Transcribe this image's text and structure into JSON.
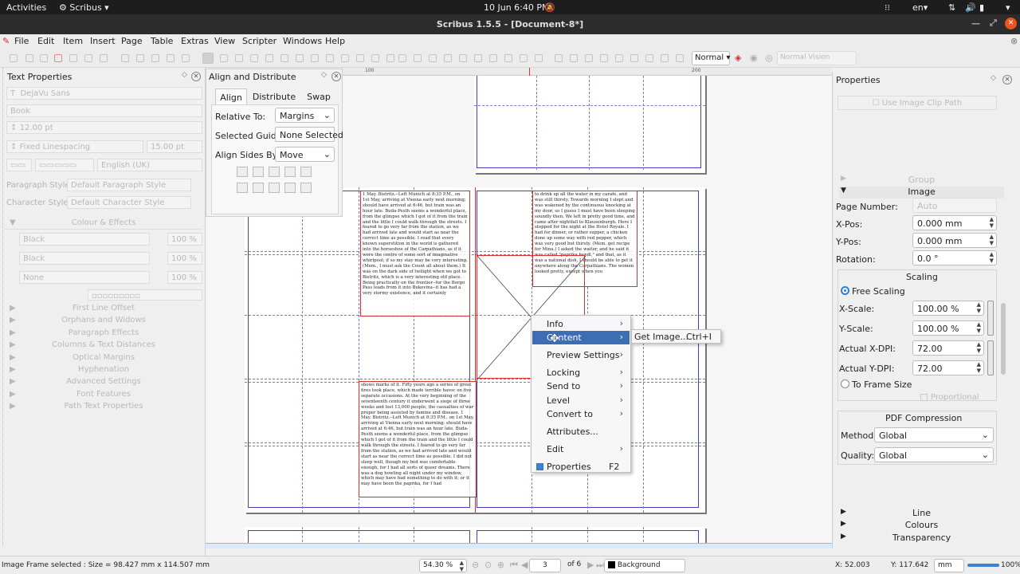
{
  "system": {
    "activities": "Activities",
    "app_menu": "Scribus ▾",
    "clock": "10 Jun  6:40 PM",
    "language": "en▾",
    "battery": "100%"
  },
  "window": {
    "title": "Scribus 1.5.5 - [Document-8*]"
  },
  "menu": [
    "File",
    "Edit",
    "Item",
    "Insert",
    "Page",
    "Table",
    "Extras",
    "View",
    "Scripter",
    "Windows",
    "Help"
  ],
  "toolbar": {
    "mode": "Normal",
    "vision": "Normal Vision"
  },
  "text_props": {
    "title": "Text Properties",
    "font": "DejaVu Sans",
    "style": "Book",
    "size": "12.00 pt",
    "linespacing_mode": "Fixed Linespacing",
    "linespacing": "15.00 pt",
    "language": "English (UK)",
    "paragraph_style_label": "Paragraph Style:",
    "paragraph_style": "Default Paragraph Style",
    "character_style_label": "Character Style:",
    "character_style": "Default Character Style",
    "colour_effects": "Colour & Effects",
    "colours": [
      {
        "name": "Black",
        "pct": "100 %"
      },
      {
        "name": "Black",
        "pct": "100 %"
      },
      {
        "name": "None",
        "pct": "100 %"
      }
    ],
    "sections": [
      "First Line Offset",
      "Orphans and Widows",
      "Paragraph Effects",
      "Columns & Text Distances",
      "Optical Margins",
      "Hyphenation",
      "Advanced Settings",
      "Font Features",
      "Path Text Properties"
    ]
  },
  "align": {
    "title": "Align and Distribute",
    "tabs": [
      "Align",
      "Distribute",
      "Swap"
    ],
    "relative_label": "Relative To:",
    "relative_value": "Margins",
    "guide_label": "Selected Guide:",
    "guide_value": "None Selected",
    "sides_label": "Align Sides By:",
    "sides_value": "Move"
  },
  "ruler": [
    "100",
    "200"
  ],
  "frames": {
    "a": "1 May. Bistritz.--Left Munich at 8:35 P.M., on 1st May, arriving at Vienna early next morning; should have arrived at 6:46, but train was an hour late. Buda-Pesth seems a wonderful place, from the glimpse which I got of it from the train and the little I could walk through the streets. I feared to go very far from the station, as we had arrived late and would start as near the correct time as possible. I read that every known superstition in the world is gathered into the horseshoe of the Carpathians, as if it were the centre of some sort of imaginative whirlpool; if so my stay may be very interesting. (Mem., I must ask the Count all about them.) It was on the dark side of twilight when we got to Bistritz, which is a very interesting old place. Being practically on the frontier--for the Borgo Pass leads from it into Bukovina--it has had a very stormy existence, and it certainly",
    "b": "to drink up all the water in my carafe, and was still thirsty. Towards morning I slept and was wakened by the continuous knocking at my door, so I guess I must have been sleeping soundly then. We left in pretty good time, and came after nightfall to Klausenburgh. Here I stopped for the night at the Hotel Royale. I had for dinner, or rather supper, a chicken done up some way with red pepper, which was very good but thirsty. (Mem. get recipe for Mina.) I asked the waiter, and he said it was called \"paprika hendl,\" and that, as it was a national dish, I should be able to get it anywhere along the Carpathians. The women looked pretty, except when you",
    "c": "shows marks of it. Fifty years ago a series of great fires took place, which made terrible havoc on five separate occasions. At the very beginning of the seventeenth century it underwent a siege of three weeks and lost 13,000 people, the casualties of war proper being assisted by famine and disease. 1 May. Bistritz.--Left Munich at 8:35 P.M., on 1st May, arriving at Vienna early next morning; should have arrived at 6:46, but train was an hour late. Buda-Pesth seems a wonderful place, from the glimpse which I got of it from the train and the little I could walk through the streets. I feared to go very far from the station, as we had arrived late and would start as near the correct time as possible. I did not sleep well, though my bed was comfortable enough, for I had all sorts of queer dreams. There was a dog howling all night under my window, which may have had something to do with it; or it may have been the paprika, for I had"
  },
  "context_menu": [
    {
      "label": "Info",
      "sub": true
    },
    {
      "label": "Content",
      "sub": true,
      "active": true
    },
    {
      "label": "Preview Settings",
      "sub": true
    },
    {
      "label": "Locking",
      "sub": true
    },
    {
      "label": "Send to",
      "sub": true
    },
    {
      "label": "Level",
      "sub": true
    },
    {
      "label": "Convert to",
      "sub": true
    },
    {
      "label": "Attributes..."
    },
    {
      "label": "Edit",
      "sub": true
    },
    {
      "label": "Properties",
      "shortcut": "F2"
    }
  ],
  "submenu": {
    "label": "Get Image...",
    "shortcut": "Ctrl+I"
  },
  "properties": {
    "title": "Properties",
    "clip_path": "Use Image Clip Path",
    "group": "Group",
    "image": "Image",
    "page_number_label": "Page Number:",
    "page_number": "Auto",
    "xpos_label": "X-Pos:",
    "xpos": "0.000 mm",
    "ypos_label": "Y-Pos:",
    "ypos": "0.000 mm",
    "rotation_label": "Rotation:",
    "rotation": "0.0 °",
    "scaling": "Scaling",
    "free_scaling": "Free Scaling",
    "xscale_label": "X-Scale:",
    "xscale": "100.00 %",
    "yscale_label": "Y-Scale:",
    "yscale": "100.00 %",
    "xdpi_label": "Actual X-DPI:",
    "xdpi": "72.00",
    "ydpi_label": "Actual Y-DPI:",
    "ydpi": "72.00",
    "to_frame": "To Frame Size",
    "proportional": "Proportional",
    "pdf_compression": "PDF Compression",
    "method_label": "Method:",
    "method": "Global",
    "quality_label": "Quality:",
    "quality": "Global",
    "line": "Line",
    "colours": "Colours",
    "transparency": "Transparency"
  },
  "status": {
    "message": "Image Frame selected : Size = 98.427 mm x 114.507 mm",
    "zoom": "54.30 %",
    "page": "3",
    "page_of": "of 6",
    "layer": "Background",
    "x": "X:  52.003",
    "y": "Y:  117.642",
    "unit": "mm",
    "pct": "100%"
  }
}
